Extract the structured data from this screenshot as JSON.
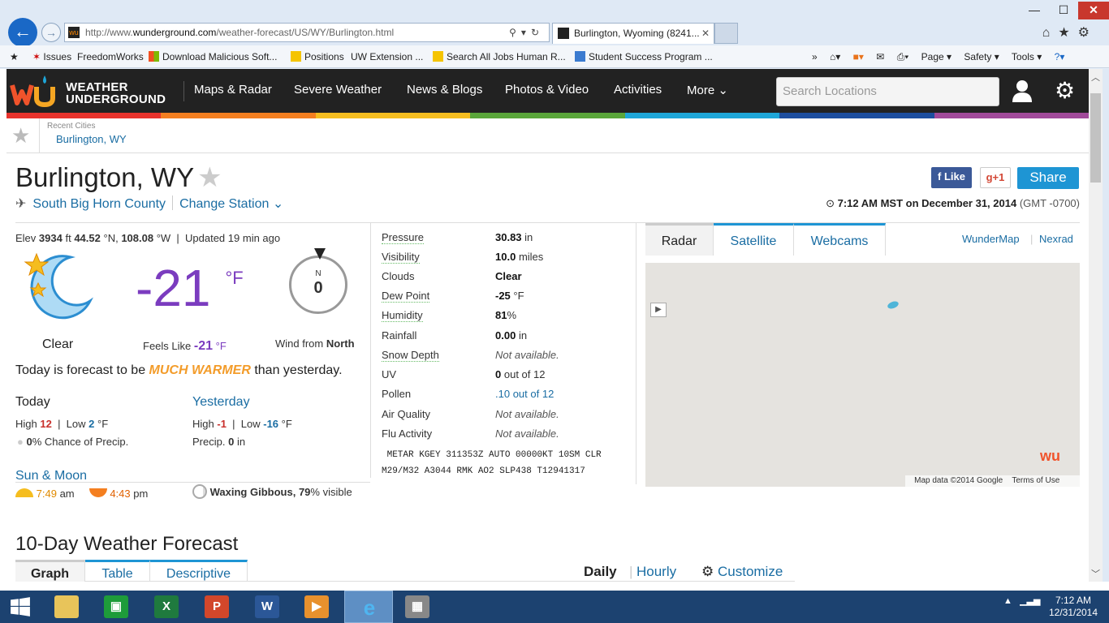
{
  "browser": {
    "url_prefix": "http://www.",
    "url_domain": "wunderground.com",
    "url_path": "/weather-forecast/US/WY/Burlington.html",
    "tab_title": "Burlington, Wyoming (8241...",
    "favorites": [
      "Issues",
      "FreedomWorks",
      "Download Malicious Soft...",
      "Positions",
      "UW Extension ...",
      "Search All Jobs",
      "Human R...",
      "Student Success Program ..."
    ],
    "commands": [
      "Page ▾",
      "Safety ▾",
      "Tools ▾"
    ]
  },
  "site": {
    "logo_line1": "WEATHER",
    "logo_line2": "UNDERGROUND",
    "nav": [
      "Maps & Radar",
      "Severe Weather",
      "News & Blogs",
      "Photos & Video",
      "Activities",
      "More"
    ],
    "search_placeholder": "Search Locations",
    "rainbow": [
      "#e8322c",
      "#f47f20",
      "#f5bd1f",
      "#5aa63a",
      "#1ea6d8",
      "#1d4e9f",
      "#a14a9a"
    ]
  },
  "recent": {
    "label": "Recent Cities",
    "city": "Burlington, WY"
  },
  "location": {
    "title": "Burlington, WY",
    "county": "South Big Horn County",
    "change_station": "Change Station",
    "fb_like": "Like",
    "gplus": "g+1",
    "share": "Share",
    "obs_time": "7:12 AM MST on December 31, 2014",
    "gmt": "(GMT -0700)"
  },
  "current": {
    "elev_label": "Elev",
    "elev": "3934",
    "elev_unit": "ft",
    "lat": "44.52",
    "lat_unit": "°N,",
    "lon": "108.08",
    "lon_unit": "°W",
    "updated": "Updated",
    "updated_ago": "19 min ago",
    "condition": "Clear",
    "temp": "-21",
    "temp_unit": "°F",
    "feels_label": "Feels Like",
    "feels": "-21",
    "feels_unit": "°F",
    "wind_dir_letter": "N",
    "wind_speed": "0",
    "wind_label": "Wind from",
    "wind_dir": "North",
    "forecast_pre": "Today is forecast to be",
    "forecast_word": "MUCH WARMER",
    "forecast_post": "than yesterday."
  },
  "today": {
    "label": "Today",
    "high_label": "High",
    "high": "12",
    "low_label": "Low",
    "low": "2",
    "unit": "°F",
    "precip_pct": "0",
    "precip_text": "% Chance of Precip."
  },
  "yesterday": {
    "label": "Yesterday",
    "high_label": "High",
    "high": "-1",
    "low_label": "Low",
    "low": "-16",
    "unit": "°F",
    "precip_label": "Precip.",
    "precip": "0",
    "precip_unit": "in"
  },
  "sunmoon": {
    "title": "Sun & Moon",
    "sunrise": "7:49",
    "sunrise_ampm": "am",
    "sunset": "4:43",
    "sunset_ampm": "pm",
    "moon_phase": "Waxing Gibbous,",
    "moon_pct": "79",
    "moon_suffix": "% visible"
  },
  "conditions": [
    {
      "label": "Pressure",
      "value": "30.83",
      "unit": "in"
    },
    {
      "label": "Visibility",
      "value": "10.0",
      "unit": "miles"
    },
    {
      "label": "Clouds",
      "value": "Clear",
      "unit": ""
    },
    {
      "label": "Dew Point",
      "value": "-25",
      "unit": "°F"
    },
    {
      "label": "Humidity",
      "value": "81",
      "unit": "%"
    },
    {
      "label": "Rainfall",
      "value": "0.00",
      "unit": "in"
    },
    {
      "label": "Snow Depth",
      "value": "Not available.",
      "unit": ""
    },
    {
      "label": "UV",
      "value": "0",
      "unit": "out of 12"
    },
    {
      "label": "Pollen",
      "value": ".10",
      "unit": "out of 12"
    },
    {
      "label": "Air Quality",
      "value": "Not available.",
      "unit": ""
    },
    {
      "label": "Flu Activity",
      "value": "Not available.",
      "unit": ""
    }
  ],
  "metar_line1": "METAR KGEY 311353Z AUTO 00000KT 10SM CLR",
  "metar_line2": "M29/M32 A3044 RMK AO2 SLP438 T12941317",
  "map": {
    "tabs": [
      "Radar",
      "Satellite",
      "Webcams"
    ],
    "links": [
      "WunderMap",
      "Nexrad"
    ],
    "attribution": "Map data ©2014 Google",
    "terms": "Terms of Use"
  },
  "tenday": {
    "title": "10-Day Weather Forecast",
    "tabs": [
      "Graph",
      "Table",
      "Descriptive"
    ],
    "daily": "Daily",
    "hourly": "Hourly",
    "customize": "Customize"
  },
  "taskbar": {
    "time": "7:12 AM",
    "date": "12/31/2014"
  }
}
